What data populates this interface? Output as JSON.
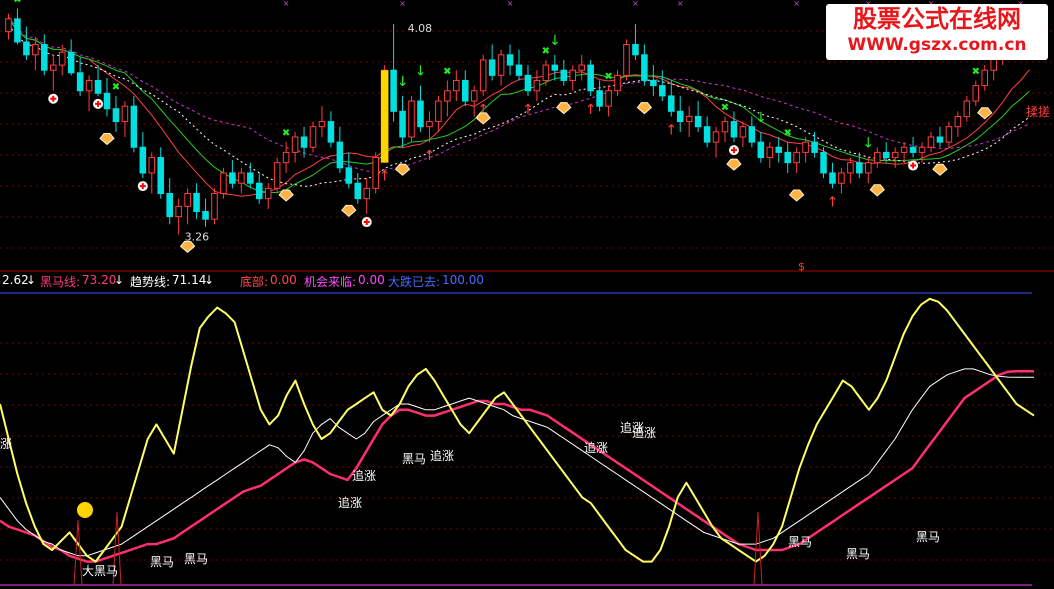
{
  "watermark": {
    "line1": "股票公式在线网",
    "line2": "WWW.gszx.com.cn"
  },
  "info_bar": {
    "v0": "2.62",
    "heima_label": "黑马线:",
    "heima_value": "73.20",
    "qushi_label": "趋势线:",
    "qushi_value": "71.14",
    "dibu_label": "底部:",
    "dibu_value": "0.00",
    "jihui_label": "机会来临:",
    "jihui_value": "0.00",
    "dadie_label": "大跌已去:",
    "dadie_value": "100.00",
    "arrow": "↓"
  },
  "colors": {
    "up": "#ff3d3d",
    "down": "#00e0e0",
    "flat": "#ffffff",
    "heima": "#ff2f6f",
    "qushi": "#ffffff",
    "yellow": "#ffff66",
    "magenta": "#ff3cff",
    "green": "#22cc22",
    "watermark": "#e8161b"
  },
  "chart_data": [
    {
      "type": "candlestick",
      "annotations": {
        "high": "4.08",
        "low": "3.26",
        "right_label": "揉搓",
        "bottom_mark": "$"
      },
      "candles": [
        [
          4.05,
          4.12,
          4.02,
          4.1
        ],
        [
          4.1,
          4.14,
          4.0,
          4.01
        ],
        [
          4.01,
          4.07,
          3.94,
          3.96
        ],
        [
          3.96,
          4.03,
          3.9,
          4.0
        ],
        [
          4.0,
          4.04,
          3.88,
          3.9
        ],
        [
          3.9,
          3.96,
          3.82,
          3.92
        ],
        [
          3.92,
          4.0,
          3.88,
          3.97
        ],
        [
          3.97,
          4.02,
          3.88,
          3.89
        ],
        [
          3.89,
          3.95,
          3.8,
          3.82
        ],
        [
          3.82,
          3.88,
          3.74,
          3.86
        ],
        [
          3.86,
          3.92,
          3.8,
          3.81
        ],
        [
          3.81,
          3.87,
          3.72,
          3.75
        ],
        [
          3.75,
          3.8,
          3.66,
          3.7
        ],
        [
          3.7,
          3.78,
          3.64,
          3.76
        ],
        [
          3.76,
          3.8,
          3.58,
          3.6
        ],
        [
          3.6,
          3.66,
          3.48,
          3.5
        ],
        [
          3.5,
          3.58,
          3.42,
          3.56
        ],
        [
          3.56,
          3.6,
          3.4,
          3.42
        ],
        [
          3.42,
          3.48,
          3.3,
          3.33
        ],
        [
          3.33,
          3.4,
          3.26,
          3.37
        ],
        [
          3.37,
          3.44,
          3.3,
          3.42
        ],
        [
          3.42,
          3.46,
          3.32,
          3.35
        ],
        [
          3.35,
          3.4,
          3.29,
          3.32
        ],
        [
          3.32,
          3.44,
          3.3,
          3.42
        ],
        [
          3.42,
          3.52,
          3.4,
          3.5
        ],
        [
          3.5,
          3.55,
          3.44,
          3.46
        ],
        [
          3.46,
          3.52,
          3.42,
          3.5
        ],
        [
          3.5,
          3.54,
          3.44,
          3.46
        ],
        [
          3.46,
          3.5,
          3.38,
          3.4
        ],
        [
          3.4,
          3.46,
          3.36,
          3.44
        ],
        [
          3.44,
          3.56,
          3.42,
          3.54
        ],
        [
          3.54,
          3.62,
          3.5,
          3.58
        ],
        [
          3.58,
          3.66,
          3.54,
          3.64
        ],
        [
          3.64,
          3.68,
          3.56,
          3.6
        ],
        [
          3.6,
          3.7,
          3.58,
          3.68
        ],
        [
          3.68,
          3.76,
          3.64,
          3.7
        ],
        [
          3.7,
          3.74,
          3.6,
          3.62
        ],
        [
          3.62,
          3.68,
          3.5,
          3.52
        ],
        [
          3.52,
          3.58,
          3.44,
          3.46
        ],
        [
          3.46,
          3.5,
          3.38,
          3.4
        ],
        [
          3.4,
          3.48,
          3.34,
          3.44
        ],
        [
          3.44,
          3.58,
          3.42,
          3.56
        ],
        [
          3.56,
          3.92,
          3.54,
          3.9
        ],
        [
          3.9,
          4.08,
          3.7,
          3.74
        ],
        [
          3.74,
          3.8,
          3.6,
          3.64
        ],
        [
          3.64,
          3.8,
          3.62,
          3.78
        ],
        [
          3.78,
          3.84,
          3.66,
          3.68
        ],
        [
          3.68,
          3.74,
          3.62,
          3.7
        ],
        [
          3.7,
          3.8,
          3.66,
          3.78
        ],
        [
          3.78,
          3.86,
          3.72,
          3.82
        ],
        [
          3.82,
          3.9,
          3.78,
          3.86
        ],
        [
          3.86,
          3.9,
          3.76,
          3.78
        ],
        [
          3.78,
          3.84,
          3.72,
          3.82
        ],
        [
          3.82,
          3.96,
          3.8,
          3.94
        ],
        [
          3.94,
          4.0,
          3.86,
          3.88
        ],
        [
          3.88,
          3.98,
          3.84,
          3.96
        ],
        [
          3.96,
          4.0,
          3.88,
          3.92
        ],
        [
          3.92,
          3.98,
          3.86,
          3.88
        ],
        [
          3.88,
          3.92,
          3.8,
          3.82
        ],
        [
          3.82,
          3.9,
          3.78,
          3.86
        ],
        [
          3.86,
          3.94,
          3.84,
          3.92
        ],
        [
          3.92,
          3.96,
          3.86,
          3.9
        ],
        [
          3.9,
          3.94,
          3.84,
          3.86
        ],
        [
          3.86,
          3.92,
          3.82,
          3.9
        ],
        [
          3.9,
          3.96,
          3.86,
          3.92
        ],
        [
          3.92,
          3.94,
          3.8,
          3.82
        ],
        [
          3.82,
          3.86,
          3.74,
          3.76
        ],
        [
          3.76,
          3.84,
          3.72,
          3.82
        ],
        [
          3.82,
          3.9,
          3.8,
          3.88
        ],
        [
          3.88,
          4.02,
          3.86,
          4.0
        ],
        [
          4.0,
          4.08,
          3.94,
          3.96
        ],
        [
          3.96,
          4.0,
          3.84,
          3.86
        ],
        [
          3.86,
          3.92,
          3.8,
          3.84
        ],
        [
          3.84,
          3.9,
          3.78,
          3.8
        ],
        [
          3.8,
          3.86,
          3.72,
          3.74
        ],
        [
          3.74,
          3.8,
          3.66,
          3.7
        ],
        [
          3.7,
          3.76,
          3.64,
          3.72
        ],
        [
          3.72,
          3.78,
          3.66,
          3.68
        ],
        [
          3.68,
          3.72,
          3.6,
          3.62
        ],
        [
          3.62,
          3.68,
          3.56,
          3.66
        ],
        [
          3.66,
          3.72,
          3.62,
          3.7
        ],
        [
          3.7,
          3.74,
          3.62,
          3.64
        ],
        [
          3.64,
          3.7,
          3.6,
          3.68
        ],
        [
          3.68,
          3.72,
          3.6,
          3.62
        ],
        [
          3.62,
          3.66,
          3.54,
          3.56
        ],
        [
          3.56,
          3.62,
          3.52,
          3.6
        ],
        [
          3.6,
          3.64,
          3.54,
          3.58
        ],
        [
          3.58,
          3.62,
          3.5,
          3.54
        ],
        [
          3.54,
          3.6,
          3.5,
          3.58
        ],
        [
          3.58,
          3.64,
          3.54,
          3.62
        ],
        [
          3.62,
          3.66,
          3.56,
          3.58
        ],
        [
          3.58,
          3.6,
          3.48,
          3.5
        ],
        [
          3.5,
          3.54,
          3.44,
          3.46
        ],
        [
          3.46,
          3.52,
          3.42,
          3.5
        ],
        [
          3.5,
          3.56,
          3.46,
          3.54
        ],
        [
          3.54,
          3.58,
          3.48,
          3.5
        ],
        [
          3.5,
          3.56,
          3.46,
          3.54
        ],
        [
          3.54,
          3.6,
          3.52,
          3.58
        ],
        [
          3.58,
          3.62,
          3.54,
          3.56
        ],
        [
          3.56,
          3.6,
          3.52,
          3.58
        ],
        [
          3.58,
          3.62,
          3.54,
          3.6
        ],
        [
          3.6,
          3.64,
          3.56,
          3.58
        ],
        [
          3.58,
          3.62,
          3.54,
          3.6
        ],
        [
          3.6,
          3.66,
          3.58,
          3.64
        ],
        [
          3.64,
          3.68,
          3.6,
          3.62
        ],
        [
          3.62,
          3.7,
          3.6,
          3.68
        ],
        [
          3.68,
          3.74,
          3.64,
          3.72
        ],
        [
          3.72,
          3.8,
          3.7,
          3.78
        ],
        [
          3.78,
          3.86,
          3.76,
          3.84
        ],
        [
          3.84,
          3.92,
          3.82,
          3.9
        ],
        [
          3.9,
          3.98,
          3.86,
          3.96
        ],
        [
          3.96,
          4.04,
          3.92,
          4.02
        ],
        [
          4.02,
          4.12,
          4.0,
          4.1
        ],
        [
          4.1,
          4.14,
          3.94,
          3.98
        ],
        [
          3.98,
          4.06,
          3.94,
          4.04
        ]
      ],
      "buy_arrows": [
        42,
        47,
        53,
        58,
        65,
        74,
        92
      ],
      "sell_arrows": [
        44,
        46,
        61,
        84,
        96
      ],
      "x_marks": [
        1,
        12,
        31,
        49,
        60,
        67,
        80,
        87,
        108
      ],
      "diamonds": [
        11,
        20,
        31,
        38,
        44,
        53,
        62,
        71,
        81,
        88,
        97,
        104,
        109
      ],
      "plus_marks": [
        5,
        10,
        15,
        40,
        81,
        101
      ],
      "top_marks": [
        31,
        44,
        56,
        70,
        75,
        88,
        96,
        103,
        113
      ]
    },
    {
      "type": "line",
      "ylim": [
        0,
        100
      ],
      "x_count": 120,
      "series": [
        {
          "name": "黑马线",
          "values": [
            22,
            20,
            19,
            18,
            17,
            15,
            13,
            12,
            10,
            9,
            8,
            8,
            9,
            10,
            11,
            12,
            13,
            14,
            14,
            15,
            16,
            18,
            20,
            22,
            24,
            26,
            28,
            30,
            32,
            33,
            34,
            36,
            38,
            40,
            42,
            43,
            42,
            40,
            38,
            37,
            36,
            40,
            45,
            50,
            55,
            58,
            60,
            60,
            59,
            58,
            58,
            59,
            60,
            61,
            62,
            63,
            63,
            62,
            62,
            61,
            60,
            60,
            59,
            58,
            56,
            54,
            52,
            50,
            48,
            46,
            44,
            42,
            40,
            38,
            36,
            34,
            32,
            30,
            28,
            26,
            24,
            22,
            20,
            18,
            16,
            14,
            13,
            12,
            12,
            12,
            12,
            13,
            14,
            16,
            18,
            20,
            22,
            24,
            26,
            28,
            30,
            32,
            34,
            36,
            38,
            40,
            44,
            48,
            52,
            56,
            60,
            64,
            66,
            68,
            70,
            72,
            73,
            73.2,
            73.2,
            73.2
          ]
        },
        {
          "name": "趋势线",
          "values": [
            30,
            26,
            22,
            19,
            17,
            15,
            14,
            12,
            11,
            10,
            10,
            11,
            12,
            13,
            14,
            16,
            18,
            20,
            22,
            24,
            26,
            28,
            30,
            32,
            34,
            36,
            38,
            40,
            42,
            44,
            46,
            48,
            47,
            44,
            42,
            46,
            52,
            55,
            57,
            54,
            52,
            50,
            52,
            56,
            58,
            60,
            62,
            62,
            61,
            60,
            60,
            61,
            62,
            63,
            64,
            63,
            62,
            61,
            60,
            58,
            57,
            56,
            55,
            54,
            52,
            50,
            48,
            46,
            44,
            42,
            40,
            38,
            36,
            34,
            32,
            30,
            28,
            26,
            24,
            22,
            20,
            18,
            17,
            16,
            15,
            14,
            14,
            14,
            15,
            16,
            18,
            20,
            22,
            24,
            26,
            28,
            30,
            32,
            34,
            36,
            38,
            42,
            46,
            50,
            55,
            60,
            64,
            68,
            70,
            72,
            73,
            74,
            74,
            73,
            72,
            71.5,
            71.2,
            71.14,
            71.14,
            71.14
          ]
        },
        {
          "name": "",
          "values": [
            62,
            50,
            38,
            28,
            20,
            14,
            12,
            15,
            18,
            14,
            10,
            8,
            12,
            16,
            20,
            30,
            40,
            50,
            55,
            50,
            45,
            60,
            75,
            88,
            92,
            95,
            93,
            90,
            80,
            70,
            60,
            55,
            58,
            65,
            70,
            62,
            55,
            50,
            52,
            56,
            60,
            62,
            64,
            66,
            60,
            58,
            62,
            68,
            72,
            74,
            70,
            65,
            60,
            55,
            52,
            56,
            60,
            64,
            66,
            62,
            58,
            54,
            50,
            46,
            42,
            38,
            34,
            30,
            28,
            24,
            20,
            16,
            12,
            10,
            8,
            8,
            12,
            20,
            30,
            35,
            30,
            25,
            20,
            16,
            14,
            12,
            10,
            8,
            10,
            14,
            20,
            30,
            40,
            48,
            55,
            60,
            65,
            70,
            68,
            64,
            60,
            64,
            70,
            78,
            86,
            92,
            96,
            98,
            97,
            94,
            90,
            86,
            82,
            78,
            74,
            70,
            66,
            62,
            60,
            58
          ]
        }
      ],
      "labels": [
        "涨",
        "大黑马",
        "黑马",
        "黑马",
        "追涨",
        "追涨",
        "黑马",
        "追涨",
        "追涨",
        "追涨",
        "追涨",
        "黑马",
        "黑马",
        "黑马"
      ]
    }
  ]
}
